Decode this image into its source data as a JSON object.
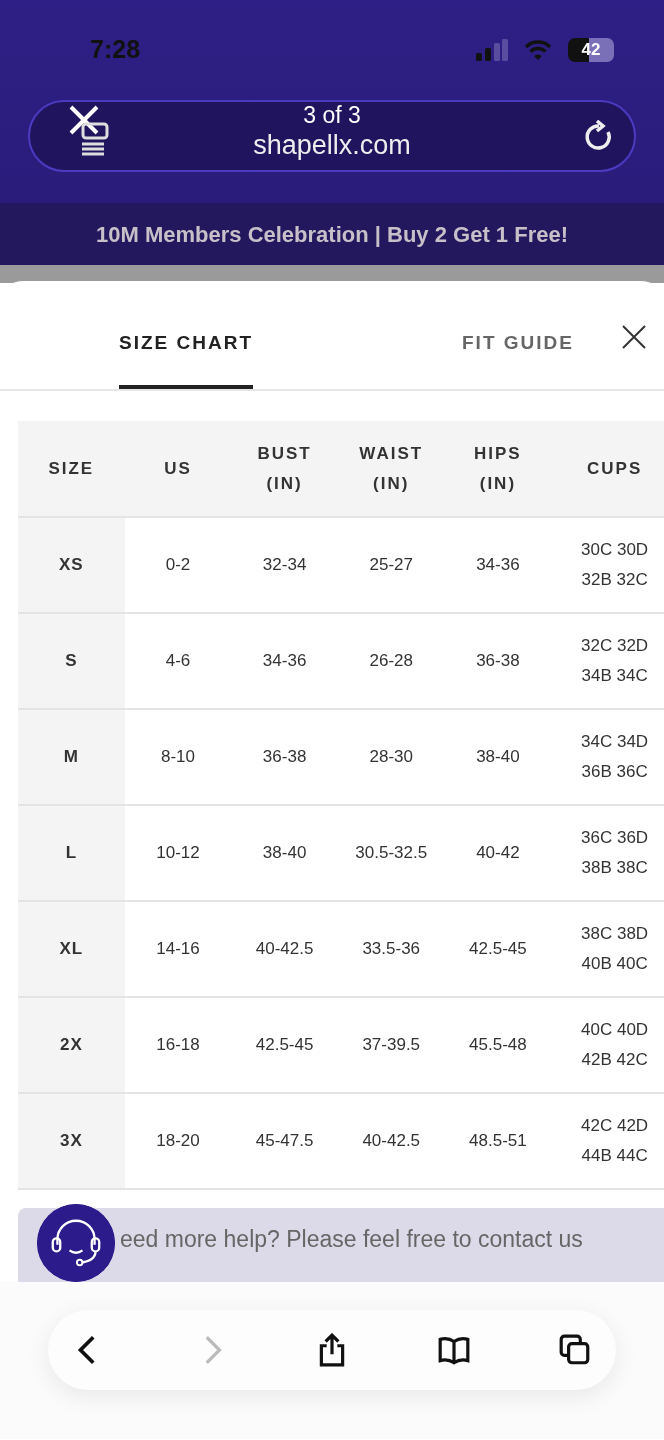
{
  "status_bar": {
    "time": "7:28",
    "battery": "42"
  },
  "browser": {
    "tab_count": "3 of 3",
    "url": "shapellx.com"
  },
  "promo_banner": "10M Members Celebration | Buy 2 Get 1 Free!",
  "tabs": [
    {
      "label": "SIZE CHART",
      "selected": true
    },
    {
      "label": "FIT GUIDE",
      "selected": false
    }
  ],
  "table": {
    "columns": [
      "SIZE",
      "US",
      "BUST (IN)",
      "WAIST (IN)",
      "HIPS (IN)",
      "CUPS"
    ],
    "rows": [
      [
        "XS",
        "0-2",
        "32-34",
        "25-27",
        "34-36",
        "30C 30D 32B 32C"
      ],
      [
        "S",
        "4-6",
        "34-36",
        "26-28",
        "36-38",
        "32C 32D 34B 34C"
      ],
      [
        "M",
        "8-10",
        "36-38",
        "28-30",
        "38-40",
        "34C 34D 36B 36C"
      ],
      [
        "L",
        "10-12",
        "38-40",
        "30.5-32.5",
        "40-42",
        "36C 36D 38B 38C"
      ],
      [
        "XL",
        "14-16",
        "40-42.5",
        "33.5-36",
        "42.5-45",
        "38C 38D 40B 40C"
      ],
      [
        "2X",
        "16-18",
        "42.5-45",
        "37-39.5",
        "45.5-48",
        "40C 40D 42B 42C"
      ],
      [
        "3X",
        "18-20",
        "45-47.5",
        "40-42.5",
        "48.5-51",
        "42C 42D 44B 44C"
      ]
    ]
  },
  "help_banner": "eed more help? Please feel free to contact us",
  "toolbar": [
    {
      "kind": "back",
      "disabled": false
    },
    {
      "kind": "forward",
      "disabled": true
    },
    {
      "kind": "share",
      "disabled": false
    },
    {
      "kind": "bookmarks",
      "disabled": false
    },
    {
      "kind": "tabs",
      "disabled": false
    }
  ]
}
